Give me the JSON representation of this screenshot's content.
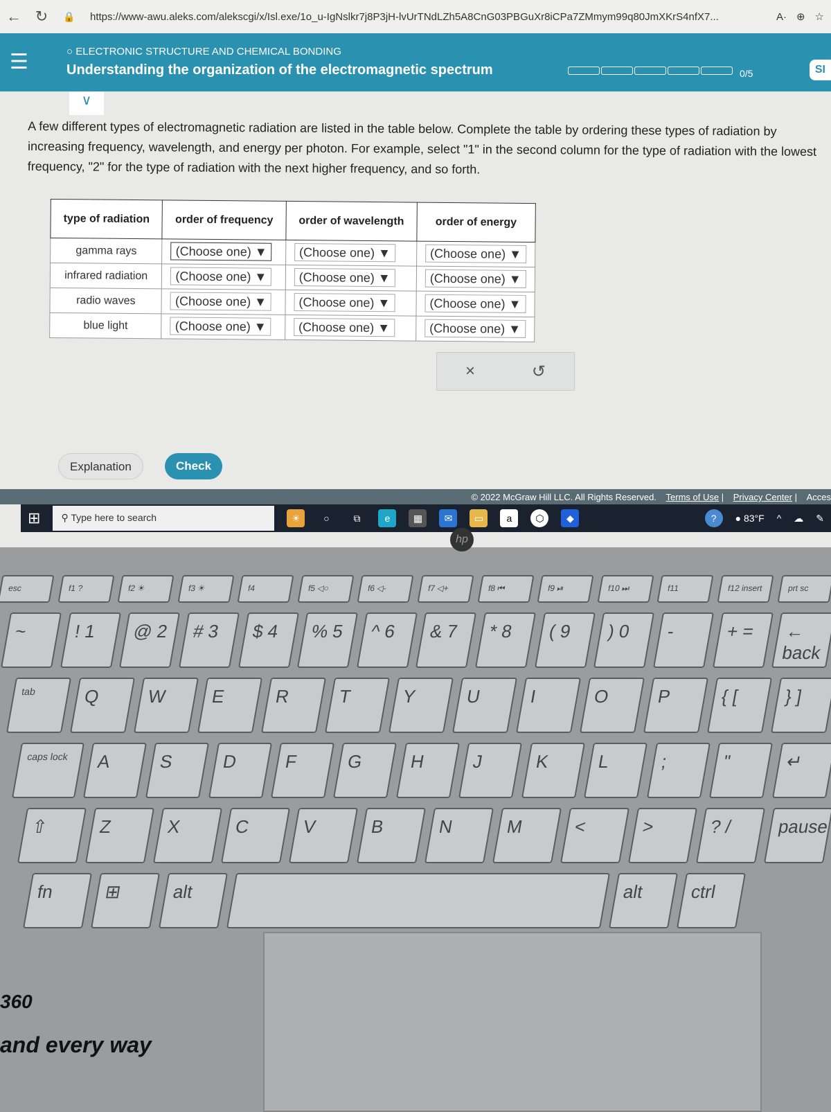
{
  "browser": {
    "url": "https://www-awu.aleks.com/alekscgi/x/Isl.exe/1o_u-IgNslkr7j8P3jH-lvUrTNdLZh5A8CnG03PBGuXr8iCPa7ZMmym99q80JmXKrS4nfX7...",
    "read_aloud": "A·"
  },
  "header": {
    "topic": "ELECTRONIC STRUCTURE AND CHEMICAL BONDING",
    "title": "Understanding the organization of the electromagnetic spectrum",
    "score": "0/5",
    "progress_segments": 5,
    "progress_complete": 0,
    "accent": "#2a91b0",
    "corner": "SI"
  },
  "instructions": "A few different types of electromagnetic radiation are listed in the table below. Complete the table by ordering these types of radiation by increasing frequency, wavelength, and energy per photon. For example, select \"1\" in the second column for the type of radiation with the lowest frequency, \"2\" for the type of radiation with the next higher frequency, and so forth.",
  "table": {
    "headers": [
      "type of radiation",
      "order of frequency",
      "order of wavelength",
      "order of energy"
    ],
    "rows": [
      {
        "type": "gamma rays",
        "freq": "(Choose one) ▼",
        "wave": "(Choose one) ▼",
        "energy": "(Choose one) ▼"
      },
      {
        "type": "infrared radiation",
        "freq": "(Choose one) ▼",
        "wave": "(Choose one) ▼",
        "energy": "(Choose one) ▼"
      },
      {
        "type": "radio waves",
        "freq": "(Choose one) ▼",
        "wave": "(Choose one) ▼",
        "energy": "(Choose one) ▼"
      },
      {
        "type": "blue light",
        "freq": "(Choose one) ▼",
        "wave": "(Choose one) ▼",
        "energy": "(Choose one) ▼"
      }
    ]
  },
  "tools": {
    "clear": "×",
    "undo": "↺"
  },
  "buttons": {
    "explanation": "Explanation",
    "check": "Check"
  },
  "footer": {
    "copyright": "© 2022 McGraw Hill LLC. All Rights Reserved.",
    "terms": "Terms of Use",
    "privacy": "Privacy Center",
    "access": "Acces"
  },
  "taskbar": {
    "search_placeholder": "Type here to search",
    "temp": "83°F",
    "amazon": "a"
  },
  "keyboard": {
    "rows": [
      [
        "esc",
        "f1 ?",
        "f2 ☀",
        "f3 ☀",
        "f4",
        "f5 ◁○",
        "f6 ◁-",
        "f7 ◁+",
        "f8 ⏮",
        "f9 ⏯",
        "f10 ⏭",
        "f11",
        "f12 insert",
        "prt sc"
      ],
      [
        "~",
        "! 1",
        "@ 2",
        "# 3",
        "$ 4",
        "% 5",
        "^ 6",
        "& 7",
        "* 8",
        "( 9",
        ") 0",
        "-",
        "+ =",
        "← back"
      ],
      [
        "tab",
        "Q",
        "W",
        "E",
        "R",
        "T",
        "Y",
        "U",
        "I",
        "O",
        "P",
        "{ [",
        "} ]"
      ],
      [
        "caps lock",
        "A",
        "S",
        "D",
        "F",
        "G",
        "H",
        "J",
        "K",
        "L",
        ";",
        "\"",
        "↵"
      ],
      [
        "⇧",
        "Z",
        "X",
        "C",
        "V",
        "B",
        "N",
        "M",
        "<",
        ">",
        "? /",
        "pause"
      ],
      [
        "fn",
        "⊞",
        "alt",
        "",
        "alt",
        "ctrl"
      ]
    ]
  },
  "brand": {
    "line1": "360",
    "line2": "and every way",
    "logo": "hp"
  }
}
